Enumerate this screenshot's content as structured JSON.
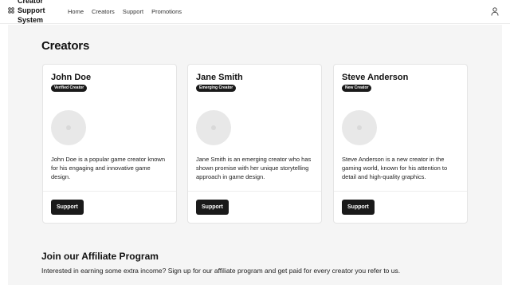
{
  "header": {
    "brand_name": "Creator Support System",
    "brand_icon": "grid-icon",
    "nav": [
      "Home",
      "Creators",
      "Support",
      "Promotions"
    ],
    "user_icon": "user-icon"
  },
  "main": {
    "title": "Creators",
    "creators": [
      {
        "name": "John Doe",
        "badge": "Verified Creator",
        "description": "John Doe is a popular game creator known for his engaging and innovative game design.",
        "button": "Support"
      },
      {
        "name": "Jane Smith",
        "badge": "Emerging Creator",
        "description": "Jane Smith is an emerging creator who has shown promise with her unique storytelling approach in game design.",
        "button": "Support"
      },
      {
        "name": "Steve Anderson",
        "badge": "New Creator",
        "description": "Steve Anderson is a new creator in the gaming world, known for his attention to detail and high-quality graphics.",
        "button": "Support"
      }
    ]
  },
  "affiliate": {
    "title": "Join our Affiliate Program",
    "text": "Interested in earning some extra income? Sign up for our affiliate program and get paid for every creator you refer to us."
  },
  "colors": {
    "accent": "#1a1a1a",
    "background": "#f5f5f5",
    "card": "#ffffff"
  }
}
